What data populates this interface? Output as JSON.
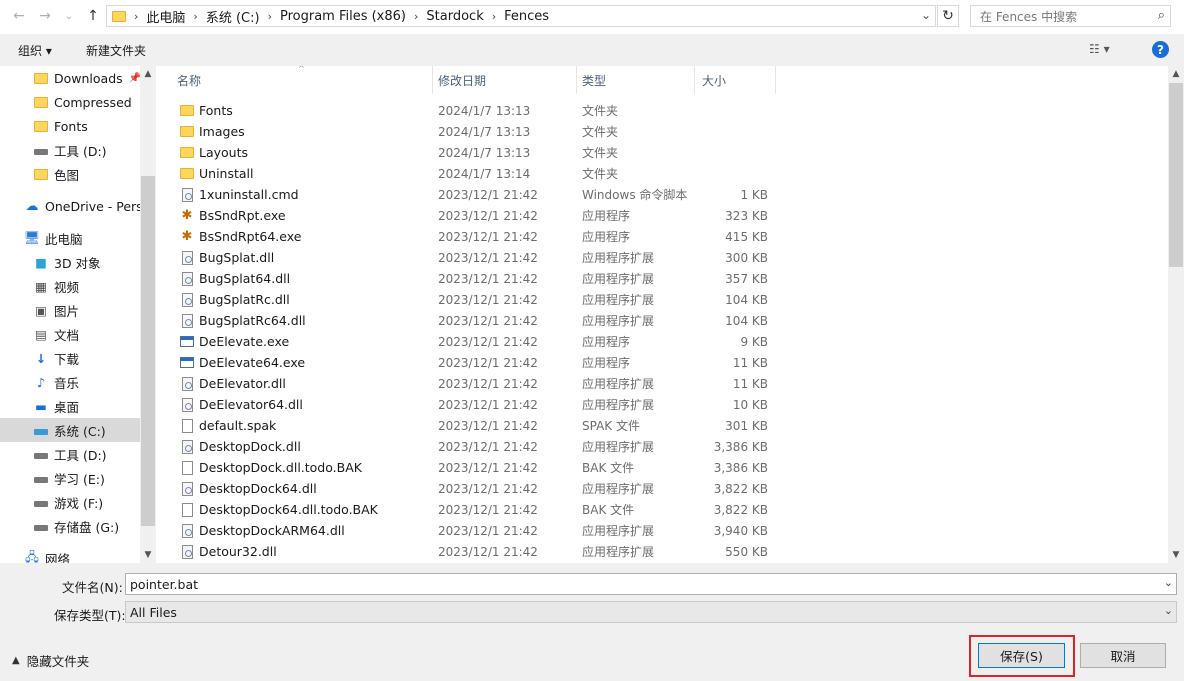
{
  "address": {
    "path": [
      "此电脑",
      "系统 (C:)",
      "Program Files (x86)",
      "Stardock",
      "Fences"
    ],
    "search_placeholder": "在 Fences 中搜索"
  },
  "toolbar": {
    "organize_label": "组织 ▾",
    "new_folder_label": "新建文件夹"
  },
  "navigation": [
    {
      "label": "Downloads",
      "icon": "folder-icon",
      "pinned": true
    },
    {
      "label": "Compressed",
      "icon": "folder-icon"
    },
    {
      "label": "Fonts",
      "icon": "folder-icon"
    },
    {
      "label": "工具 (D:)",
      "icon": "drive-icon"
    },
    {
      "label": "色图",
      "icon": "folder-icon"
    },
    {
      "label": "OneDrive - Perso",
      "icon": "cloud-icon"
    },
    {
      "label": "此电脑",
      "icon": "computer-icon"
    },
    {
      "label": "3D 对象",
      "icon": "cube-icon"
    },
    {
      "label": "视频",
      "icon": "video-icon"
    },
    {
      "label": "图片",
      "icon": "pictures-icon"
    },
    {
      "label": "文档",
      "icon": "documents-icon"
    },
    {
      "label": "下载",
      "icon": "download-icon"
    },
    {
      "label": "音乐",
      "icon": "music-icon"
    },
    {
      "label": "桌面",
      "icon": "desktop-icon"
    },
    {
      "label": "系统 (C:)",
      "icon": "drive-icon",
      "selected": true
    },
    {
      "label": "工具 (D:)",
      "icon": "drive-icon"
    },
    {
      "label": "学习 (E:)",
      "icon": "drive-icon"
    },
    {
      "label": "游戏 (F:)",
      "icon": "drive-icon"
    },
    {
      "label": "存储盘 (G:)",
      "icon": "drive-icon"
    },
    {
      "label": "网络",
      "icon": "network-icon"
    }
  ],
  "columns": {
    "name": "名称",
    "date": "修改日期",
    "type": "类型",
    "size": "大小"
  },
  "files": [
    {
      "name": "Fonts",
      "date": "2024/1/7 13:13",
      "type": "文件夹",
      "size": "",
      "icon": "folder-icon"
    },
    {
      "name": "Images",
      "date": "2024/1/7 13:13",
      "type": "文件夹",
      "size": "",
      "icon": "folder-icon"
    },
    {
      "name": "Layouts",
      "date": "2024/1/7 13:13",
      "type": "文件夹",
      "size": "",
      "icon": "folder-icon"
    },
    {
      "name": "Uninstall",
      "date": "2024/1/7 13:14",
      "type": "文件夹",
      "size": "",
      "icon": "folder-icon"
    },
    {
      "name": "1xuninstall.cmd",
      "date": "2023/12/1 21:42",
      "type": "Windows 命令脚本",
      "size": "1 KB",
      "icon": "script-icon"
    },
    {
      "name": "BsSndRpt.exe",
      "date": "2023/12/1 21:42",
      "type": "应用程序",
      "size": "323 KB",
      "icon": "bug-icon"
    },
    {
      "name": "BsSndRpt64.exe",
      "date": "2023/12/1 21:42",
      "type": "应用程序",
      "size": "415 KB",
      "icon": "bug-icon"
    },
    {
      "name": "BugSplat.dll",
      "date": "2023/12/1 21:42",
      "type": "应用程序扩展",
      "size": "300 KB",
      "icon": "dll-icon"
    },
    {
      "name": "BugSplat64.dll",
      "date": "2023/12/1 21:42",
      "type": "应用程序扩展",
      "size": "357 KB",
      "icon": "dll-icon"
    },
    {
      "name": "BugSplatRc.dll",
      "date": "2023/12/1 21:42",
      "type": "应用程序扩展",
      "size": "104 KB",
      "icon": "dll-icon"
    },
    {
      "name": "BugSplatRc64.dll",
      "date": "2023/12/1 21:42",
      "type": "应用程序扩展",
      "size": "104 KB",
      "icon": "dll-icon"
    },
    {
      "name": "DeElevate.exe",
      "date": "2023/12/1 21:42",
      "type": "应用程序",
      "size": "9 KB",
      "icon": "exe-icon"
    },
    {
      "name": "DeElevate64.exe",
      "date": "2023/12/1 21:42",
      "type": "应用程序",
      "size": "11 KB",
      "icon": "exe-icon"
    },
    {
      "name": "DeElevator.dll",
      "date": "2023/12/1 21:42",
      "type": "应用程序扩展",
      "size": "11 KB",
      "icon": "dll-icon"
    },
    {
      "name": "DeElevator64.dll",
      "date": "2023/12/1 21:42",
      "type": "应用程序扩展",
      "size": "10 KB",
      "icon": "dll-icon"
    },
    {
      "name": "default.spak",
      "date": "2023/12/1 21:42",
      "type": "SPAK 文件",
      "size": "301 KB",
      "icon": "file-icon"
    },
    {
      "name": "DesktopDock.dll",
      "date": "2023/12/1 21:42",
      "type": "应用程序扩展",
      "size": "3,386 KB",
      "icon": "dll-icon"
    },
    {
      "name": "DesktopDock.dll.todo.BAK",
      "date": "2023/12/1 21:42",
      "type": "BAK 文件",
      "size": "3,386 KB",
      "icon": "file-icon"
    },
    {
      "name": "DesktopDock64.dll",
      "date": "2023/12/1 21:42",
      "type": "应用程序扩展",
      "size": "3,822 KB",
      "icon": "dll-icon"
    },
    {
      "name": "DesktopDock64.dll.todo.BAK",
      "date": "2023/12/1 21:42",
      "type": "BAK 文件",
      "size": "3,822 KB",
      "icon": "file-icon"
    },
    {
      "name": "DesktopDockARM64.dll",
      "date": "2023/12/1 21:42",
      "type": "应用程序扩展",
      "size": "3,940 KB",
      "icon": "dll-icon"
    },
    {
      "name": "Detour32.dll",
      "date": "2023/12/1 21:42",
      "type": "应用程序扩展",
      "size": "550 KB",
      "icon": "dll-icon"
    }
  ],
  "form": {
    "filename_label": "文件名(N):",
    "filename_value": "pointer.bat",
    "filetype_label": "保存类型(T):",
    "filetype_value": "All Files"
  },
  "footer": {
    "hide_folders_label": "隐藏文件夹",
    "save_label": "保存(S)",
    "cancel_label": "取消"
  },
  "colors": {
    "accent": "#0078d7",
    "highlight": "#e0222a",
    "folder": "#ffd65c"
  }
}
